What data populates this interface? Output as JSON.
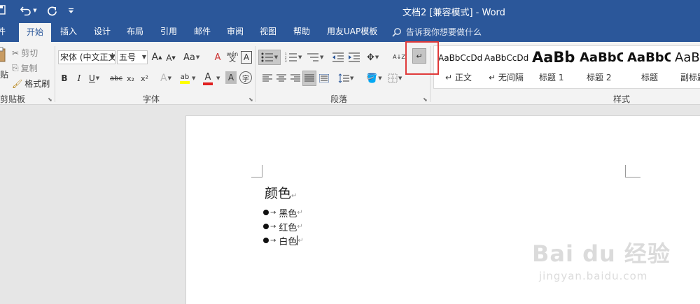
{
  "window": {
    "title": "文档2 [兼容模式]  -  Word"
  },
  "qat": {
    "save_icon": "save-icon",
    "undo_icon": "undo-icon",
    "redo_icon": "repeat-icon",
    "customize_icon": "customize-qat-icon"
  },
  "tabs": [
    {
      "label": "件"
    },
    {
      "label": "开始"
    },
    {
      "label": "插入"
    },
    {
      "label": "设计"
    },
    {
      "label": "布局"
    },
    {
      "label": "引用"
    },
    {
      "label": "邮件"
    },
    {
      "label": "审阅"
    },
    {
      "label": "视图"
    },
    {
      "label": "帮助"
    },
    {
      "label": "用友UAP模板"
    }
  ],
  "tell_me": {
    "placeholder": "告诉我你想要做什么"
  },
  "clipboard": {
    "paste_label": "贴",
    "cut_label": "剪切",
    "copy_label": "复制",
    "format_painter_label": "格式刷",
    "group_label": "剪贴板"
  },
  "font": {
    "font_name": "宋体 (中文正文",
    "font_size": "五号",
    "grow_label": "A",
    "shrink_label": "A",
    "case_label": "Aa",
    "clear_label": "A",
    "phonetic_label": "wén",
    "border_label": "A",
    "bold": "B",
    "italic": "I",
    "underline": "U",
    "strike": "abc",
    "subscript": "x₂",
    "superscript": "x²",
    "effects": "A",
    "highlight": "ab",
    "font_color": "A",
    "char_shading": "A",
    "enclose": "㊕",
    "group_label": "字体"
  },
  "paragraph": {
    "group_label": "段落",
    "sort_label": "A↓Z"
  },
  "styles": {
    "group_label": "样式",
    "items": [
      {
        "sample": "AaBbCcDd",
        "name": "↵ 正文"
      },
      {
        "sample": "AaBbCcDd",
        "name": "↵ 无间隔"
      },
      {
        "sample": "AaBb",
        "name": "标题 1"
      },
      {
        "sample": "AaBbC",
        "name": "标题 2"
      },
      {
        "sample": "AaBbC",
        "name": "标题"
      },
      {
        "sample": "AaBbC",
        "name": "副标题"
      }
    ]
  },
  "document": {
    "heading": "颜色",
    "paragraph_mark": "↵",
    "bullets": [
      {
        "text": "黑色"
      },
      {
        "text": "红色"
      },
      {
        "text": "白色"
      }
    ]
  },
  "watermark": {
    "brand": "Bai du 经验",
    "url": "jingyan.baidu.com"
  },
  "colors": {
    "accent": "#2b579a",
    "highlight_box": "#e03a3a",
    "highlight_yellow": "#ffff00",
    "font_red": "#e02020"
  }
}
